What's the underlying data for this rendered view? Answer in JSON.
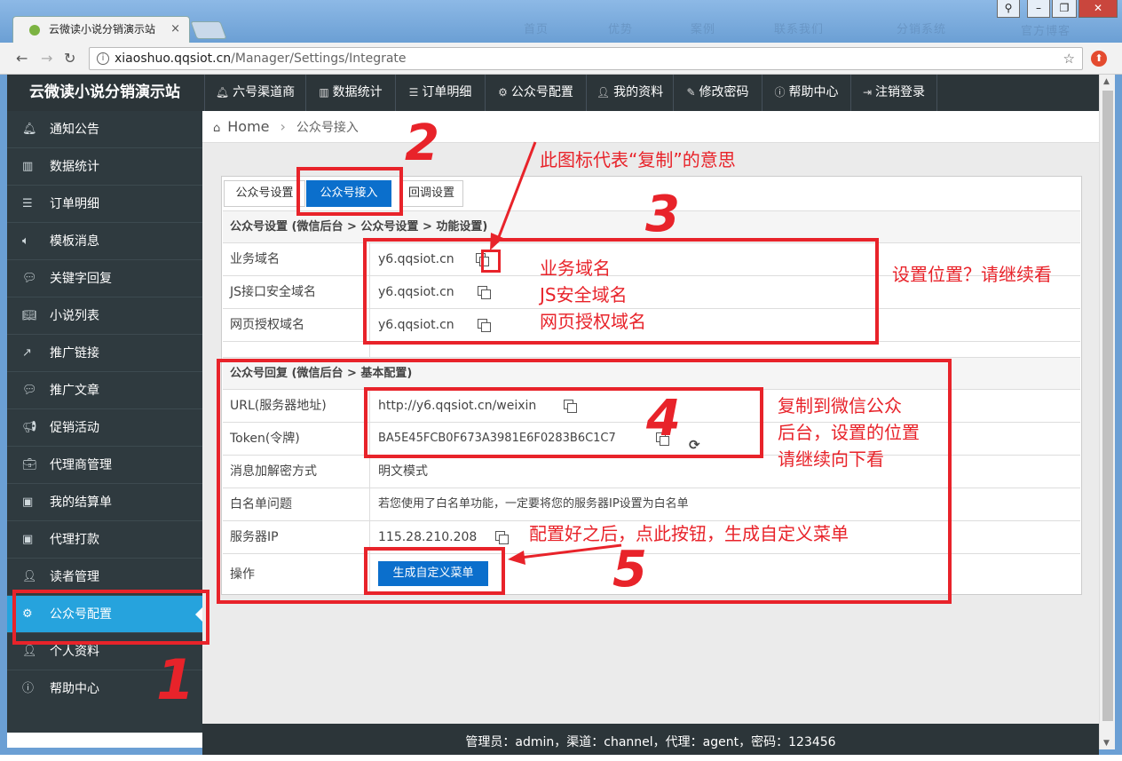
{
  "browser": {
    "tab_title": "云微读小说分销演示站",
    "tab_close": "×",
    "url_host": "xiaoshuo.qqsiot.cn",
    "url_path": "/Manager/Settings/Integrate",
    "bookmark_star": "☆",
    "ghost_links": [
      "首页",
      "优势",
      "案例",
      "联系我们",
      "分销系统",
      "官方博客"
    ]
  },
  "app": {
    "brand": "云微读小说分销演示站",
    "topnav": [
      {
        "icon": "bell-icon",
        "label": "六号渠道商"
      },
      {
        "icon": "chart-icon",
        "label": "数据统计"
      },
      {
        "icon": "list-icon",
        "label": "订单明细"
      },
      {
        "icon": "gear-icon",
        "label": "公众号配置"
      },
      {
        "icon": "user-icon",
        "label": "我的资料"
      },
      {
        "icon": "edit-icon",
        "label": "修改密码"
      },
      {
        "icon": "info-icon",
        "label": "帮助中心"
      },
      {
        "icon": "logout-icon",
        "label": "注销登录"
      }
    ],
    "sidebar": [
      {
        "icon": "bell-icon",
        "label": "通知公告"
      },
      {
        "icon": "chart-icon",
        "label": "数据统计"
      },
      {
        "icon": "list-icon",
        "label": "订单明细"
      },
      {
        "icon": "volume-icon",
        "label": "模板消息"
      },
      {
        "icon": "comment-icon",
        "label": "关键字回复"
      },
      {
        "icon": "book-icon",
        "label": "小说列表"
      },
      {
        "icon": "share-icon",
        "label": "推广链接"
      },
      {
        "icon": "comment-icon",
        "label": "推广文章"
      },
      {
        "icon": "bullhorn-icon",
        "label": "促销活动"
      },
      {
        "icon": "briefcase-icon",
        "label": "代理商管理"
      },
      {
        "icon": "money-icon",
        "label": "我的结算单"
      },
      {
        "icon": "money-icon",
        "label": "代理打款"
      },
      {
        "icon": "user-icon",
        "label": "读者管理"
      },
      {
        "icon": "gear-icon",
        "label": "公众号配置"
      },
      {
        "icon": "user-icon",
        "label": "个人资料"
      },
      {
        "icon": "info-icon",
        "label": "帮助中心"
      }
    ],
    "sidebar_active_index": 13,
    "breadcrumb": {
      "home": "Home",
      "sep": "›",
      "current": "公众号接入"
    },
    "tabs": [
      "公众号设置",
      "公众号接入",
      "回调设置"
    ],
    "active_tab": 1,
    "section1": {
      "title": "公众号设置 (微信后台 > 公众号设置 > 功能设置)",
      "rows": [
        {
          "label": "业务域名",
          "value": "y6.qqsiot.cn"
        },
        {
          "label": "JS接口安全域名",
          "value": "y6.qqsiot.cn"
        },
        {
          "label": "网页授权域名",
          "value": "y6.qqsiot.cn"
        }
      ]
    },
    "section2": {
      "title": "公众号回复 (微信后台 > 基本配置)",
      "rows": [
        {
          "label": "URL(服务器地址)",
          "value": "http://y6.qqsiot.cn/weixin"
        },
        {
          "label": "Token(令牌)",
          "value": "BA5E45FCB0F673A3981E6F0283B6C1C7"
        },
        {
          "label": "消息加解密方式",
          "value": "明文模式"
        },
        {
          "label": "白名单问题",
          "value": "若您使用了白名单功能，一定要将您的服务器IP设置为白名单"
        },
        {
          "label": "服务器IP",
          "value": "115.28.210.208"
        },
        {
          "label": "操作",
          "value": ""
        }
      ],
      "generate_button": "生成自定义菜单"
    },
    "footer": "管理员：admin，渠道：channel，代理：agent，密码：123456"
  },
  "annotations": {
    "num1": "1",
    "num2": "2",
    "num3": "3",
    "num4": "4",
    "num5": "5",
    "copy_icon_note": "此图标代表“复制”的意思",
    "domain_labels": [
      "业务域名",
      "JS安全域名",
      "网页授权域名"
    ],
    "where_note": "设置位置？请继续看",
    "copy_note": [
      "复制到微信公众",
      "后台，设置的位置",
      "请继续向下看"
    ],
    "generate_note": "配置好之后，点此按钮，生成自定义菜单",
    "color": "#e8232a"
  },
  "colors": {
    "primary": "#0b6fcc",
    "sidebar_active": "#26a3dd",
    "dark": "#2c3539"
  }
}
